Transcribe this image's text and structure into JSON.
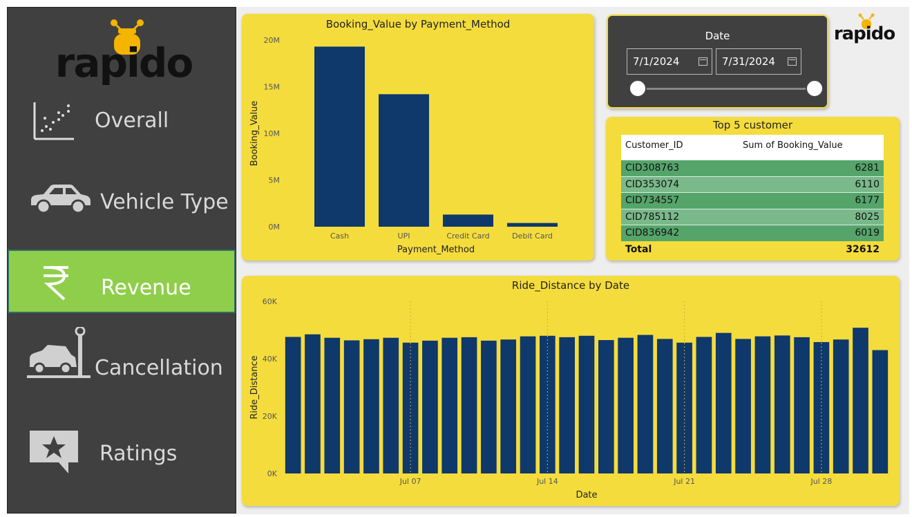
{
  "brand": {
    "name": "rapido",
    "accent": "#f4dc3c",
    "bar_color": "#0f386b",
    "active_nav": "#8fce4a",
    "sidebar_bg": "#404040"
  },
  "sidebar": {
    "items": [
      {
        "label": "Overall",
        "icon": "scatter-chart-icon",
        "active": false
      },
      {
        "label": "Vehicle Type",
        "icon": "car-icon",
        "active": false
      },
      {
        "label": "Revenue",
        "icon": "rupee-icon",
        "active": true
      },
      {
        "label": "Cancellation",
        "icon": "car-crash-icon",
        "active": false
      },
      {
        "label": "Ratings",
        "icon": "star-review-icon",
        "active": false
      }
    ]
  },
  "date_filter": {
    "title": "Date",
    "start": "7/1/2024",
    "end": "7/31/2024"
  },
  "top_customers": {
    "title": "Top 5 customer",
    "headers": [
      "Customer_ID",
      "Sum of Booking_Value"
    ],
    "rows": [
      [
        "CID308763",
        "6281"
      ],
      [
        "CID353074",
        "6110"
      ],
      [
        "CID734557",
        "6177"
      ],
      [
        "CID785112",
        "8025"
      ],
      [
        "CID836942",
        "6019"
      ]
    ],
    "total_label": "Total",
    "total_value": "32612"
  },
  "chart_data": [
    {
      "type": "bar",
      "title": "Booking_Value by Payment_Method",
      "xlabel": "Payment_Method",
      "ylabel": "Booking_Value",
      "categories": [
        "Cash",
        "UPI",
        "Credit Card",
        "Debit Card"
      ],
      "values": [
        19300000,
        14200000,
        1300000,
        400000
      ],
      "ylim": [
        0,
        20000000
      ],
      "yticks": [
        0,
        5000000,
        10000000,
        15000000,
        20000000
      ],
      "ytick_labels": [
        "0M",
        "5M",
        "10M",
        "15M",
        "20M"
      ],
      "grid": false
    },
    {
      "type": "bar",
      "title": "Ride_Distance by Date",
      "xlabel": "Date",
      "ylabel": "Ride_Distance",
      "x": [
        "2024-07-01",
        "2024-07-02",
        "2024-07-03",
        "2024-07-04",
        "2024-07-05",
        "2024-07-06",
        "2024-07-07",
        "2024-07-08",
        "2024-07-09",
        "2024-07-10",
        "2024-07-11",
        "2024-07-12",
        "2024-07-13",
        "2024-07-14",
        "2024-07-15",
        "2024-07-16",
        "2024-07-17",
        "2024-07-18",
        "2024-07-19",
        "2024-07-20",
        "2024-07-21",
        "2024-07-22",
        "2024-07-23",
        "2024-07-24",
        "2024-07-25",
        "2024-07-26",
        "2024-07-27",
        "2024-07-28",
        "2024-07-29",
        "2024-07-30",
        "2024-07-31"
      ],
      "values": [
        47600,
        48500,
        47300,
        46400,
        46800,
        47300,
        45600,
        46300,
        47300,
        47500,
        46300,
        46700,
        47800,
        48000,
        47500,
        48000,
        46500,
        47300,
        48300,
        46900,
        45600,
        47600,
        49000,
        46900,
        47800,
        48100,
        47500,
        45800,
        46700,
        50800,
        43000
      ],
      "ylim": [
        0,
        60000
      ],
      "yticks": [
        0,
        20000,
        40000,
        60000
      ],
      "ytick_labels": [
        "0K",
        "20K",
        "40K",
        "60K"
      ],
      "xtick_labels": [
        {
          "date": "2024-07-07",
          "label": "Jul 07"
        },
        {
          "date": "2024-07-14",
          "label": "Jul 14"
        },
        {
          "date": "2024-07-21",
          "label": "Jul 21"
        },
        {
          "date": "2024-07-28",
          "label": "Jul 28"
        }
      ],
      "grid": false
    }
  ]
}
